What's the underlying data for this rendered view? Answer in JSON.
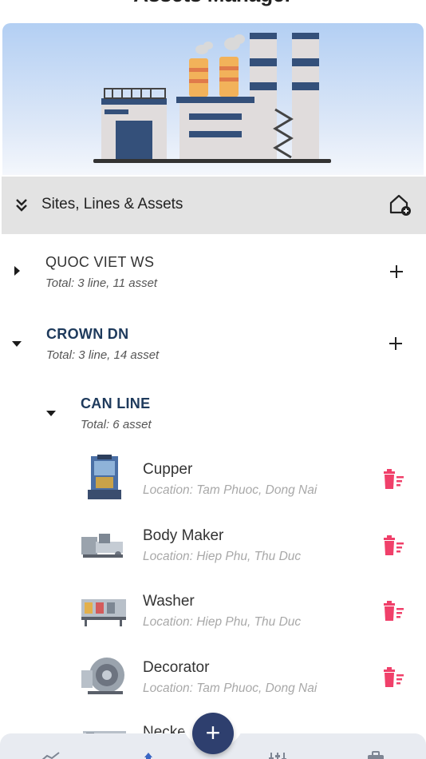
{
  "header": {
    "title": "Assets Manager"
  },
  "section": {
    "title": "Sites, Lines & Assets"
  },
  "sites": [
    {
      "name": "QUOC VIET WS",
      "summary": "Total: 3 line, 11 asset",
      "expanded": false
    },
    {
      "name": "CROWN DN",
      "summary": "Total: 3 line, 14 asset",
      "expanded": true
    }
  ],
  "line": {
    "name": "CAN LINE",
    "summary": "Total: 6 asset"
  },
  "assets": [
    {
      "name": "Cupper",
      "location": "Location: Tam Phuoc, Dong Nai"
    },
    {
      "name": "Body Maker",
      "location": "Location: Hiep Phu, Thu Duc"
    },
    {
      "name": "Washer",
      "location": "Location: Hiep Phu, Thu Duc"
    },
    {
      "name": "Decorator",
      "location": "Location: Tam Phuoc, Dong Nai"
    },
    {
      "name": "Necker",
      "location": ""
    }
  ],
  "fab": {
    "label": "+"
  },
  "colors": {
    "accent": "#2e3f6e",
    "delete": "#f0406a",
    "header_bg": "#e3e3e3",
    "site_crown": "#1e3a5c"
  },
  "icons": {
    "section_collapse": "double-chevron-down-icon",
    "add_site": "home-plus-icon",
    "delete": "delete-list-icon",
    "expand": "caret-right-icon",
    "collapse": "caret-down-icon"
  }
}
